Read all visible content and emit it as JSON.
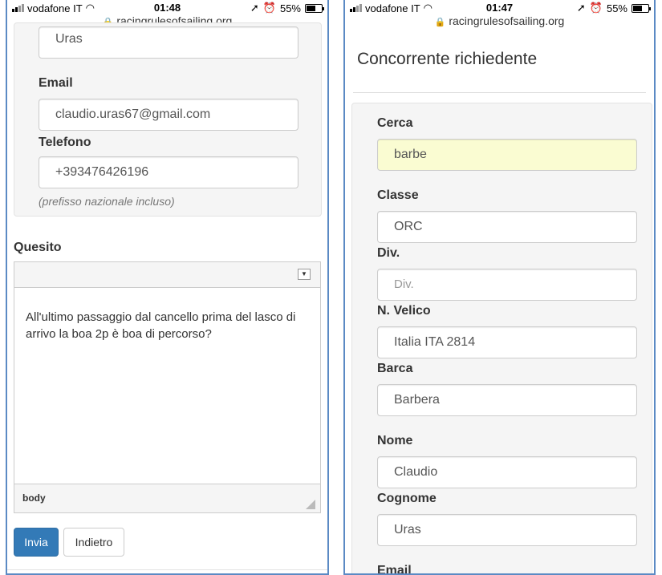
{
  "left_screen": {
    "status": {
      "carrier": "vodafone IT",
      "time": "01:48",
      "battery": "55%"
    },
    "url": "racingrulesofsailing.org",
    "fields": {
      "cognome_value": "Uras",
      "email_label": "Email",
      "email_value": "claudio.uras67@gmail.com",
      "telefono_label": "Telefono",
      "telefono_value": "+393476426196",
      "telefono_hint": "(prefisso nazionale incluso)"
    },
    "quesito": {
      "label": "Quesito",
      "text": "All'ultimo passaggio dal cancello prima del lasco di arrivo la boa 2p è boa di percorso?",
      "path": "body"
    },
    "buttons": {
      "submit": "Invia",
      "back": "Indietro"
    }
  },
  "right_screen": {
    "status": {
      "carrier": "vodafone IT",
      "time": "01:47",
      "battery": "55%"
    },
    "url": "racingrulesofsailing.org",
    "title": "Concorrente richiedente",
    "fields": {
      "cerca_label": "Cerca",
      "cerca_value": "barbe",
      "classe_label": "Classe",
      "classe_value": "ORC",
      "div_label": "Div.",
      "div_placeholder": "Div.",
      "velico_label": "N. Velico",
      "velico_value": "Italia ITA 2814",
      "barca_label": "Barca",
      "barca_value": "Barbera",
      "nome_label": "Nome",
      "nome_value": "Claudio",
      "cognome_label": "Cognome",
      "cognome_value": "Uras",
      "email_label": "Email"
    }
  },
  "colors": {
    "primary": "#337ab7",
    "highlight": "#fafcd2",
    "frame": "#5b8ac4"
  }
}
